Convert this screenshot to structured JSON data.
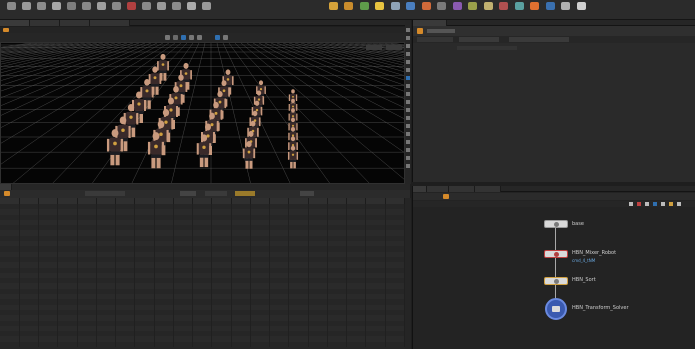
{
  "shelf": {
    "tools": [
      {
        "icon": "box-icon",
        "color": "#8a8a8a"
      },
      {
        "icon": "sphere-icon",
        "color": "#9a9a9a"
      },
      {
        "icon": "tube-icon",
        "color": "#8c8c8c"
      },
      {
        "icon": "torus-icon",
        "color": "#a7a7a7"
      },
      {
        "icon": "grid-icon",
        "color": "#7d7d7d"
      },
      {
        "icon": "curve-icon",
        "color": "#888888"
      },
      {
        "icon": "spray-icon",
        "color": "#9f9f9f"
      },
      {
        "icon": "path-icon",
        "color": "#8a8a8a"
      },
      {
        "icon": "draw-icon",
        "color": "#b04040"
      },
      {
        "icon": "l-system-icon",
        "color": "#8a8a8a"
      },
      {
        "icon": "metaball-icon",
        "color": "#9a9a9a"
      },
      {
        "icon": "file-icon",
        "color": "#8c8c8c"
      },
      {
        "icon": "null-icon",
        "color": "#aaaaaa"
      },
      {
        "icon": "point-icon",
        "color": "#999999"
      }
    ],
    "right_tools": [
      {
        "icon": "crowd-icon",
        "color": "#d4a23a"
      },
      {
        "icon": "agent-icon",
        "color": "#c98c2c"
      },
      {
        "icon": "terrain-icon",
        "color": "#5e9c4a"
      },
      {
        "icon": "light-icon",
        "color": "#e8c440"
      },
      {
        "icon": "camera-icon",
        "color": "#8fa4b8"
      },
      {
        "icon": "fluid-icon",
        "color": "#4a7fc0"
      },
      {
        "icon": "particle-icon",
        "color": "#d06a3a"
      },
      {
        "icon": "rbd-icon",
        "color": "#7a7a7a"
      },
      {
        "icon": "cloth-icon",
        "color": "#8a5ab0"
      },
      {
        "icon": "wire-icon",
        "color": "#9aa04a"
      },
      {
        "icon": "grain-icon",
        "color": "#c0b070"
      },
      {
        "icon": "muscle-icon",
        "color": "#b05050"
      },
      {
        "icon": "fx-icon",
        "color": "#5aa0a0"
      },
      {
        "icon": "pyro-icon",
        "color": "#e07030"
      },
      {
        "icon": "ocean-icon",
        "color": "#3a70b0"
      },
      {
        "icon": "vellum-icon",
        "color": "#b0b0b0"
      },
      {
        "icon": "sop-icon",
        "color": "#d0d0d0"
      }
    ]
  },
  "graph": {
    "nodes": [
      {
        "label": "base",
        "sub": ""
      },
      {
        "label": "HBN_Mixer_Robot",
        "sub": "cmd_4_tNM"
      },
      {
        "label": "HBN_Sort",
        "sub": ""
      },
      {
        "label": "HBN_Transform_Solver",
        "sub": ""
      }
    ]
  },
  "viewport": {
    "bg": "#050505",
    "grid": "#5a5a5a",
    "skin": "#c99a7e",
    "shirt": "#3a2a2a",
    "emblem": "#d0a040"
  }
}
